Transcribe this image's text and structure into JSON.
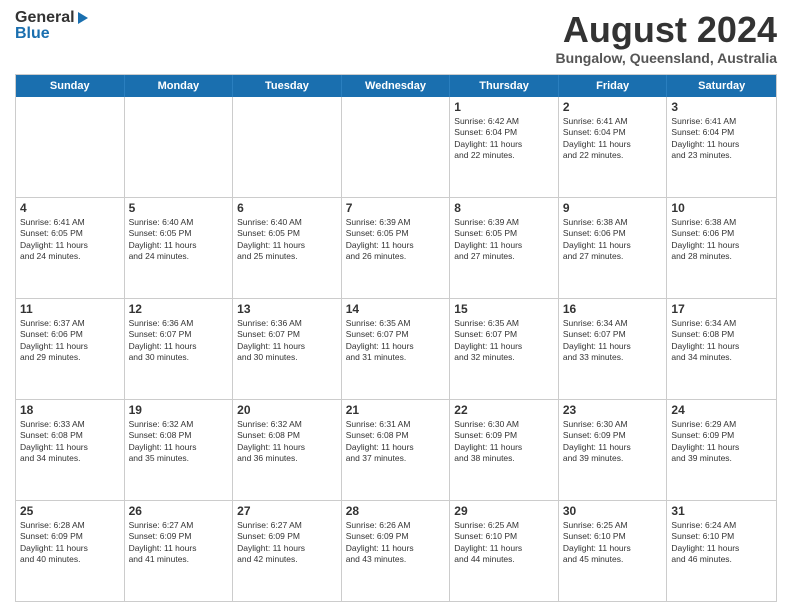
{
  "header": {
    "logo_general": "General",
    "logo_blue": "Blue",
    "month_title": "August 2024",
    "location": "Bungalow, Queensland, Australia"
  },
  "weekdays": [
    "Sunday",
    "Monday",
    "Tuesday",
    "Wednesday",
    "Thursday",
    "Friday",
    "Saturday"
  ],
  "weeks": [
    [
      {
        "day": "",
        "text": ""
      },
      {
        "day": "",
        "text": ""
      },
      {
        "day": "",
        "text": ""
      },
      {
        "day": "",
        "text": ""
      },
      {
        "day": "1",
        "text": "Sunrise: 6:42 AM\nSunset: 6:04 PM\nDaylight: 11 hours\nand 22 minutes."
      },
      {
        "day": "2",
        "text": "Sunrise: 6:41 AM\nSunset: 6:04 PM\nDaylight: 11 hours\nand 22 minutes."
      },
      {
        "day": "3",
        "text": "Sunrise: 6:41 AM\nSunset: 6:04 PM\nDaylight: 11 hours\nand 23 minutes."
      }
    ],
    [
      {
        "day": "4",
        "text": "Sunrise: 6:41 AM\nSunset: 6:05 PM\nDaylight: 11 hours\nand 24 minutes."
      },
      {
        "day": "5",
        "text": "Sunrise: 6:40 AM\nSunset: 6:05 PM\nDaylight: 11 hours\nand 24 minutes."
      },
      {
        "day": "6",
        "text": "Sunrise: 6:40 AM\nSunset: 6:05 PM\nDaylight: 11 hours\nand 25 minutes."
      },
      {
        "day": "7",
        "text": "Sunrise: 6:39 AM\nSunset: 6:05 PM\nDaylight: 11 hours\nand 26 minutes."
      },
      {
        "day": "8",
        "text": "Sunrise: 6:39 AM\nSunset: 6:05 PM\nDaylight: 11 hours\nand 27 minutes."
      },
      {
        "day": "9",
        "text": "Sunrise: 6:38 AM\nSunset: 6:06 PM\nDaylight: 11 hours\nand 27 minutes."
      },
      {
        "day": "10",
        "text": "Sunrise: 6:38 AM\nSunset: 6:06 PM\nDaylight: 11 hours\nand 28 minutes."
      }
    ],
    [
      {
        "day": "11",
        "text": "Sunrise: 6:37 AM\nSunset: 6:06 PM\nDaylight: 11 hours\nand 29 minutes."
      },
      {
        "day": "12",
        "text": "Sunrise: 6:36 AM\nSunset: 6:07 PM\nDaylight: 11 hours\nand 30 minutes."
      },
      {
        "day": "13",
        "text": "Sunrise: 6:36 AM\nSunset: 6:07 PM\nDaylight: 11 hours\nand 30 minutes."
      },
      {
        "day": "14",
        "text": "Sunrise: 6:35 AM\nSunset: 6:07 PM\nDaylight: 11 hours\nand 31 minutes."
      },
      {
        "day": "15",
        "text": "Sunrise: 6:35 AM\nSunset: 6:07 PM\nDaylight: 11 hours\nand 32 minutes."
      },
      {
        "day": "16",
        "text": "Sunrise: 6:34 AM\nSunset: 6:07 PM\nDaylight: 11 hours\nand 33 minutes."
      },
      {
        "day": "17",
        "text": "Sunrise: 6:34 AM\nSunset: 6:08 PM\nDaylight: 11 hours\nand 34 minutes."
      }
    ],
    [
      {
        "day": "18",
        "text": "Sunrise: 6:33 AM\nSunset: 6:08 PM\nDaylight: 11 hours\nand 34 minutes."
      },
      {
        "day": "19",
        "text": "Sunrise: 6:32 AM\nSunset: 6:08 PM\nDaylight: 11 hours\nand 35 minutes."
      },
      {
        "day": "20",
        "text": "Sunrise: 6:32 AM\nSunset: 6:08 PM\nDaylight: 11 hours\nand 36 minutes."
      },
      {
        "day": "21",
        "text": "Sunrise: 6:31 AM\nSunset: 6:08 PM\nDaylight: 11 hours\nand 37 minutes."
      },
      {
        "day": "22",
        "text": "Sunrise: 6:30 AM\nSunset: 6:09 PM\nDaylight: 11 hours\nand 38 minutes."
      },
      {
        "day": "23",
        "text": "Sunrise: 6:30 AM\nSunset: 6:09 PM\nDaylight: 11 hours\nand 39 minutes."
      },
      {
        "day": "24",
        "text": "Sunrise: 6:29 AM\nSunset: 6:09 PM\nDaylight: 11 hours\nand 39 minutes."
      }
    ],
    [
      {
        "day": "25",
        "text": "Sunrise: 6:28 AM\nSunset: 6:09 PM\nDaylight: 11 hours\nand 40 minutes."
      },
      {
        "day": "26",
        "text": "Sunrise: 6:27 AM\nSunset: 6:09 PM\nDaylight: 11 hours\nand 41 minutes."
      },
      {
        "day": "27",
        "text": "Sunrise: 6:27 AM\nSunset: 6:09 PM\nDaylight: 11 hours\nand 42 minutes."
      },
      {
        "day": "28",
        "text": "Sunrise: 6:26 AM\nSunset: 6:09 PM\nDaylight: 11 hours\nand 43 minutes."
      },
      {
        "day": "29",
        "text": "Sunrise: 6:25 AM\nSunset: 6:10 PM\nDaylight: 11 hours\nand 44 minutes."
      },
      {
        "day": "30",
        "text": "Sunrise: 6:25 AM\nSunset: 6:10 PM\nDaylight: 11 hours\nand 45 minutes."
      },
      {
        "day": "31",
        "text": "Sunrise: 6:24 AM\nSunset: 6:10 PM\nDaylight: 11 hours\nand 46 minutes."
      }
    ]
  ]
}
